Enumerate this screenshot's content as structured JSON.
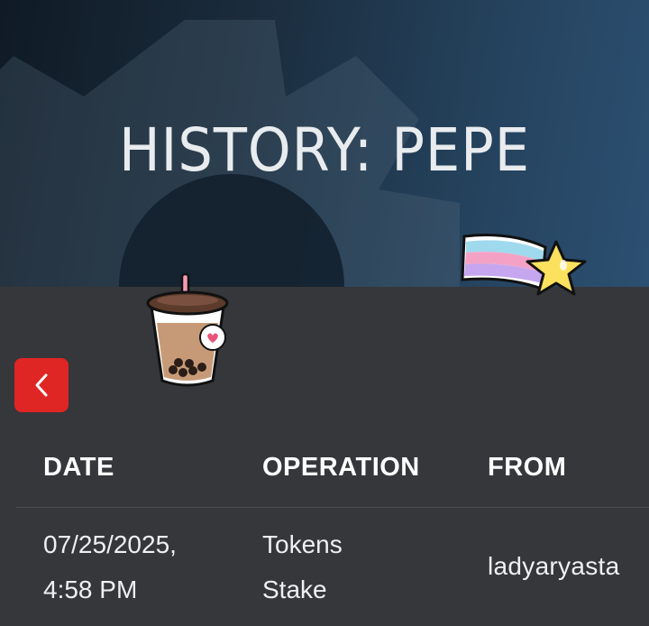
{
  "header": {
    "title": "HISTORY: PEPE"
  },
  "icons": {
    "back": "chevron-left-icon",
    "gear": "gear-icon",
    "sticker_1": "boba-tea-sticker",
    "sticker_2": "shooting-star-sticker"
  },
  "colors": {
    "hero_bg": "#1d3346",
    "page_bg": "#35373b",
    "back_button": "#e02525",
    "text": "#ffffff"
  },
  "table": {
    "columns": [
      "DATE",
      "OPERATION",
      "FROM"
    ],
    "rows": [
      {
        "date_line1": "07/25/2025,",
        "date_line2": "4:58 PM",
        "operation_line1": "Tokens",
        "operation_line2": "Stake",
        "from": "ladyaryasta"
      }
    ]
  }
}
